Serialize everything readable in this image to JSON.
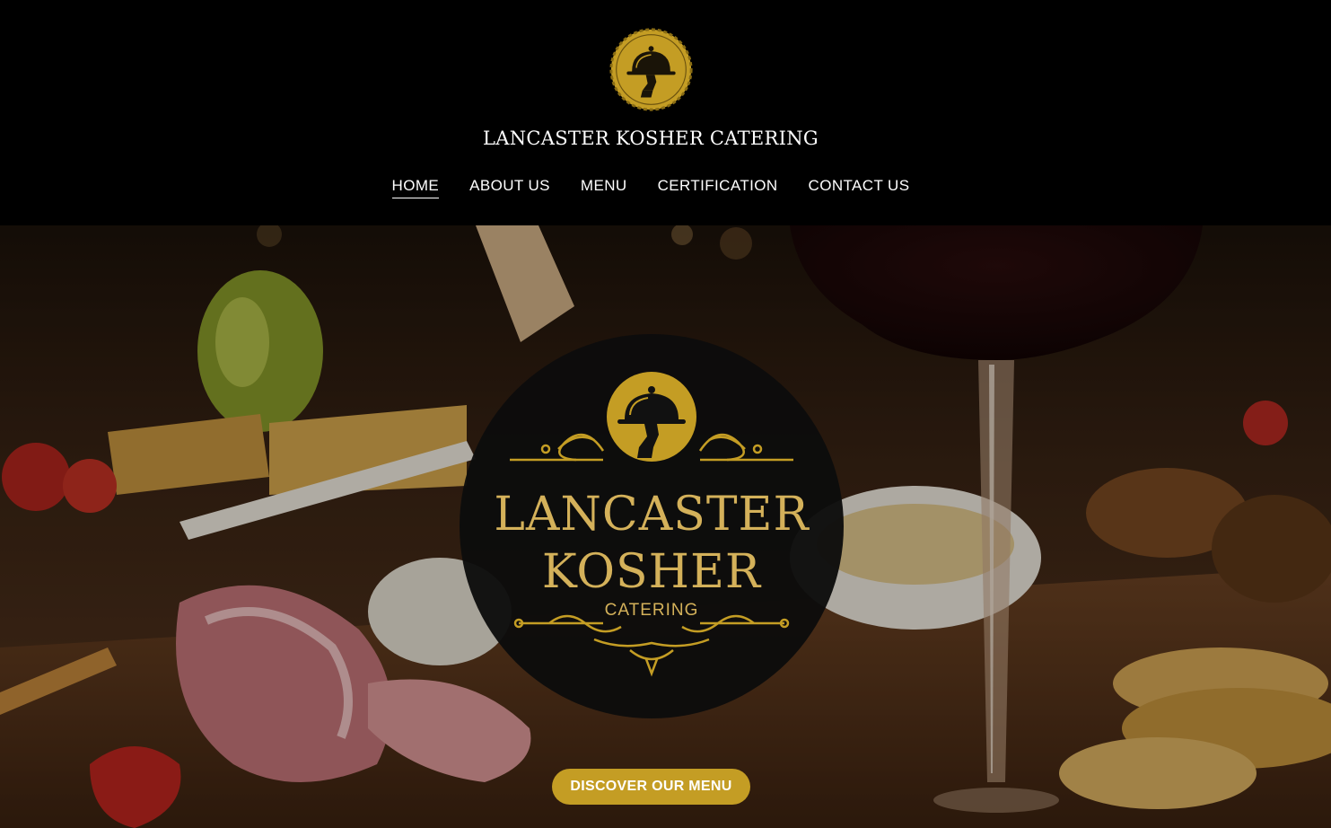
{
  "header": {
    "logo_icon": "cloche-serving-hand-emblem",
    "site_title": "LANCASTER KOSHER CATERING"
  },
  "nav": {
    "items": [
      {
        "label": "HOME",
        "active": true
      },
      {
        "label": "ABOUT US",
        "active": false
      },
      {
        "label": "MENU",
        "active": false
      },
      {
        "label": "CERTIFICATION",
        "active": false
      },
      {
        "label": "CONTACT US",
        "active": false
      }
    ]
  },
  "hero": {
    "background": "charcuterie-board-wine-glass-photo",
    "badge": {
      "line1": "LANCASTER",
      "line2": "KOSHER",
      "line3": "CATERING"
    },
    "cta_label": "DISCOVER OUR MENU"
  },
  "colors": {
    "gold": "#c49d24",
    "badge_gold_text": "#d4b15a",
    "header_bg": "#000000"
  }
}
